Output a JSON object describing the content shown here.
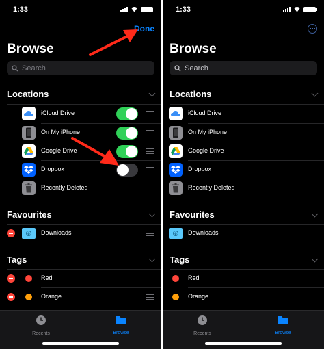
{
  "status": {
    "time": "1:33"
  },
  "header": {
    "title": "Browse",
    "done_label": "Done"
  },
  "search": {
    "placeholder": "Search"
  },
  "locations": {
    "label": "Locations",
    "items": [
      {
        "label": "iCloud Drive",
        "icon": "icloud-drive-icon",
        "enabled": true
      },
      {
        "label": "On My iPhone",
        "icon": "iphone-icon",
        "enabled": true
      },
      {
        "label": "Google Drive",
        "icon": "google-drive-icon",
        "enabled": true
      },
      {
        "label": "Dropbox",
        "icon": "dropbox-icon",
        "enabled": false
      },
      {
        "label": "Recently Deleted",
        "icon": "trash-icon"
      }
    ]
  },
  "favourites": {
    "label": "Favourites",
    "items": [
      {
        "label": "Downloads",
        "icon": "downloads-folder-icon"
      }
    ]
  },
  "tags": {
    "label": "Tags",
    "items": [
      {
        "label": "Red",
        "color": "#ff453a"
      },
      {
        "label": "Orange",
        "color": "#ff9f0a"
      }
    ]
  },
  "tabbar": {
    "recents_label": "Recents",
    "browse_label": "Browse",
    "recents_icon": "clock-icon",
    "browse_icon": "folder-icon"
  },
  "colors": {
    "accent": "#0a84ff",
    "toggle_on": "#30d158",
    "annotation_arrow": "#ff2a1a"
  }
}
